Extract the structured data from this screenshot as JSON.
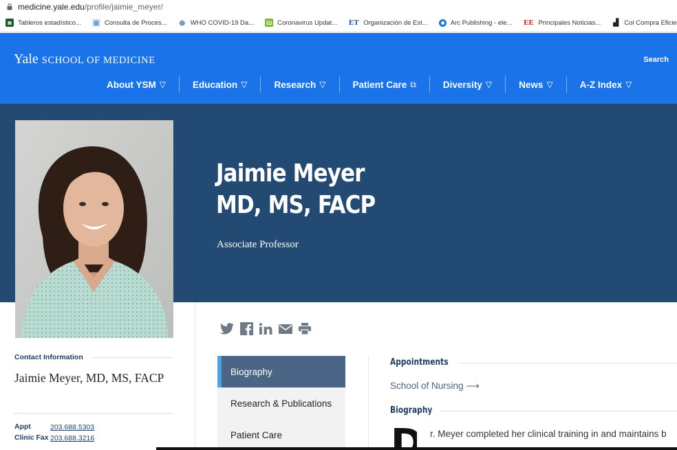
{
  "browser": {
    "url_domain": "medicine.yale.edu",
    "url_path": "/profile/jaimie_meyer/",
    "bookmarks": [
      {
        "label": "Tableros estadístico...",
        "icon": "dashboard-icon",
        "color": "#1a5c2e"
      },
      {
        "label": "Consulta de Proces...",
        "icon": "document-icon",
        "color": "#6a9fd8"
      },
      {
        "label": "WHO COVID-19 Da...",
        "icon": "globe-icon",
        "color": "#4a7ab8"
      },
      {
        "label": "Coronavirus Updat...",
        "icon": "chart-icon",
        "color": "#7cbb2a"
      },
      {
        "label": "Organización de Est...",
        "icon": "et-logo-icon",
        "color": "#1a4f9c"
      },
      {
        "label": "Arc Publishing - ele...",
        "icon": "circle-logo-icon",
        "color": "#1a73e8"
      },
      {
        "label": "Principales Noticias...",
        "icon": "ee-logo-icon",
        "color": "#c41e1e"
      },
      {
        "label": "Col Compra Eficiente",
        "icon": "bars-icon",
        "color": "#222222"
      }
    ]
  },
  "header": {
    "logo_yale": "Yale",
    "logo_school": "SCHOOL OF MEDICINE",
    "search_label": "Search",
    "nav": [
      {
        "label": "About YSM",
        "indicator": "▽"
      },
      {
        "label": "Education",
        "indicator": "▽"
      },
      {
        "label": "Research",
        "indicator": "▽"
      },
      {
        "label": "Patient Care",
        "indicator": "⧉"
      },
      {
        "label": "Diversity",
        "indicator": "▽"
      },
      {
        "label": "News",
        "indicator": "▽"
      },
      {
        "label": "A-Z Index",
        "indicator": "▽"
      }
    ],
    "bg_color": "#1a73e8"
  },
  "hero": {
    "name_line1": "Jaimie Meyer",
    "name_line2": "MD, MS, FACP",
    "title": "Associate Professor",
    "bg_color": "#234a72"
  },
  "contact": {
    "heading": "Contact Information",
    "name": "Jaimie Meyer, MD, MS, FACP",
    "phones": [
      {
        "label": "Appt",
        "number": "203.688.5303"
      },
      {
        "label": "Clinic Fax",
        "number": "203.688.3216"
      }
    ]
  },
  "share_icons": [
    "twitter-icon",
    "facebook-icon",
    "linkedin-icon",
    "email-icon",
    "print-icon"
  ],
  "tabs": [
    {
      "label": "Biography",
      "active": true
    },
    {
      "label": "Research & Publications",
      "active": false
    },
    {
      "label": "Patient Care",
      "active": false
    }
  ],
  "content": {
    "appointments_heading": "Appointments",
    "appointment_link": "School of Nursing",
    "appointment_arrow": "⟶",
    "biography_heading": "Biography",
    "dropcap": "D",
    "bio_first_line": "r. Meyer completed her clinical training in and maintains b"
  }
}
